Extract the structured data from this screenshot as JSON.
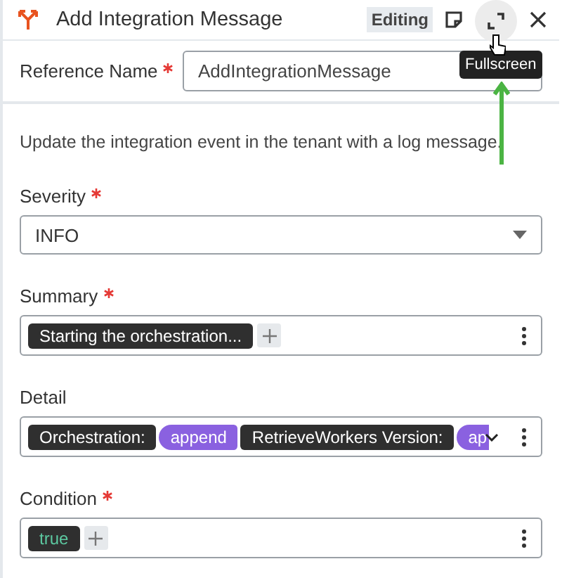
{
  "header": {
    "title": "Add Integration Message",
    "badge": "Editing"
  },
  "tooltip": {
    "text": "Fullscreen"
  },
  "reference": {
    "label": "Reference Name",
    "required": true,
    "value": "AddIntegrationMessage"
  },
  "description": "Update the integration event in the tenant with a log message.",
  "severity": {
    "label": "Severity",
    "required": true,
    "value": "INFO"
  },
  "fields": [
    {
      "label": "Summary",
      "required": true,
      "add_button": true,
      "expand_caret": false,
      "tokens": [
        {
          "kind": "text",
          "text": "Starting the orchestration..."
        }
      ]
    },
    {
      "label": "Detail",
      "required": false,
      "add_button": false,
      "expand_caret": true,
      "tokens": [
        {
          "kind": "text",
          "text": "Orchestration:"
        },
        {
          "kind": "function",
          "text": "append"
        },
        {
          "kind": "text",
          "text": "RetrieveWorkers Version:"
        },
        {
          "kind": "function",
          "text": "ap"
        }
      ]
    },
    {
      "label": "Condition",
      "required": true,
      "add_button": true,
      "expand_caret": false,
      "tokens": [
        {
          "kind": "boolean",
          "text": "true"
        }
      ]
    }
  ]
}
